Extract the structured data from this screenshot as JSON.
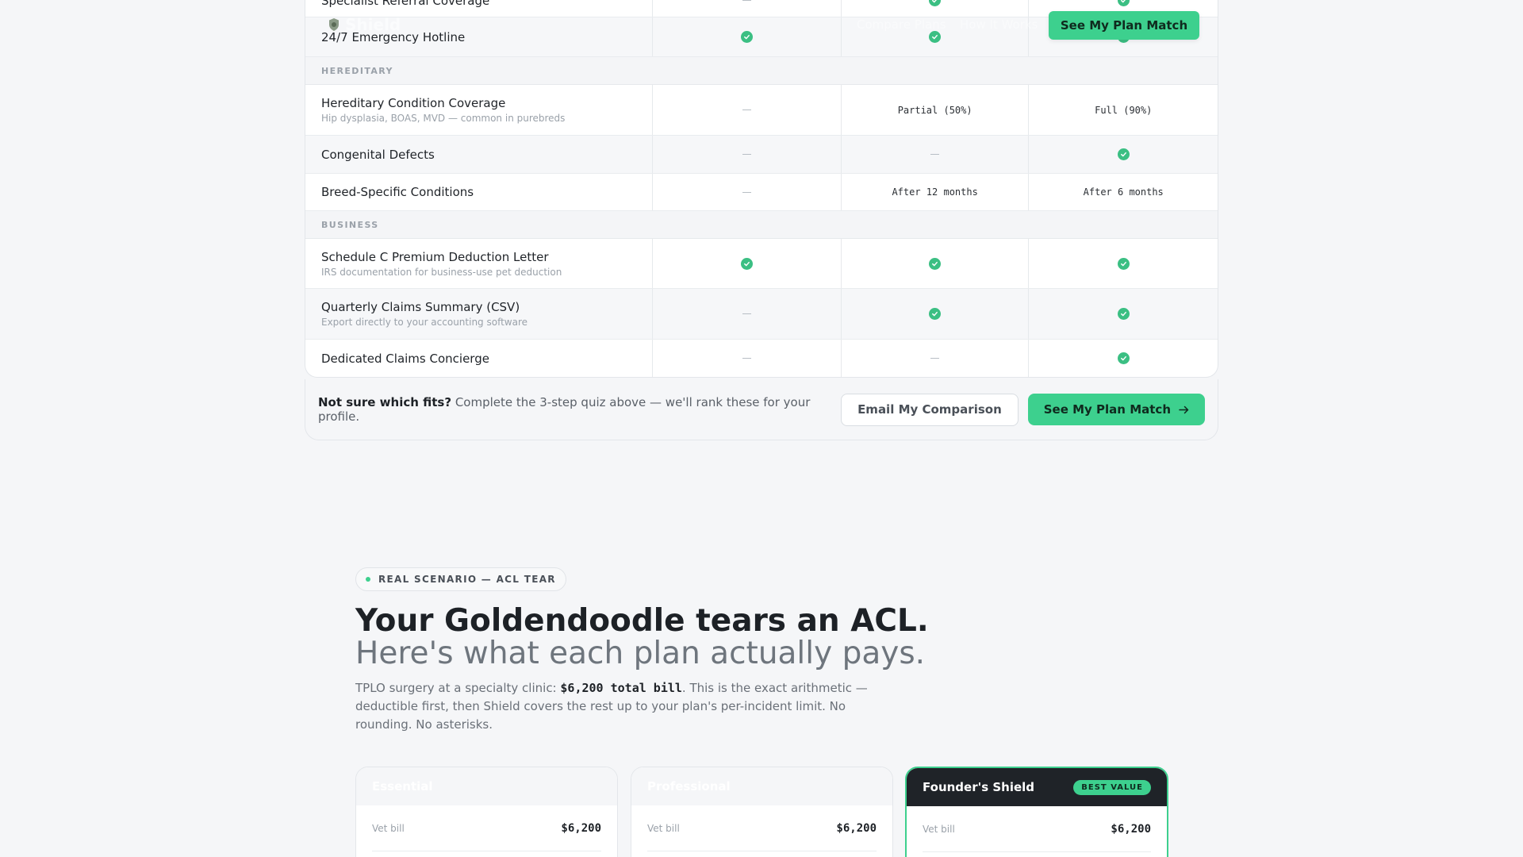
{
  "header": {
    "logo_text": "Shield",
    "nav": [
      "Compare Plans",
      "How It Works"
    ],
    "cta_label": "See My Plan Match"
  },
  "table": {
    "rows": [
      {
        "kind": "feature",
        "label": "Specialist Referral Coverage",
        "values": [
          "dash",
          "check",
          "check"
        ]
      },
      {
        "kind": "feature",
        "label": "24/7 Emergency Hotline",
        "values": [
          "check",
          "check",
          "check"
        ]
      },
      {
        "kind": "section",
        "label": "HEREDITARY"
      },
      {
        "kind": "feature",
        "label": "Hereditary Condition Coverage",
        "sub": "Hip dysplasia, BOAS, MVD — common in purebreds",
        "values": [
          "dash",
          "Partial (50%)",
          "Full (90%)"
        ]
      },
      {
        "kind": "feature",
        "label": "Congenital Defects",
        "values": [
          "dash",
          "dash",
          "check"
        ]
      },
      {
        "kind": "feature",
        "label": "Breed-Specific Conditions",
        "values": [
          "dash",
          "After 12 months",
          "After 6 months"
        ]
      },
      {
        "kind": "section",
        "label": "BUSINESS"
      },
      {
        "kind": "feature",
        "label": "Schedule C Premium Deduction Letter",
        "sub": "IRS documentation for business-use pet deduction",
        "values": [
          "check",
          "check",
          "check"
        ]
      },
      {
        "kind": "feature",
        "label": "Quarterly Claims Summary (CSV)",
        "sub": "Export directly to your accounting software",
        "values": [
          "dash",
          "check",
          "check"
        ]
      },
      {
        "kind": "feature",
        "label": "Dedicated Claims Concierge",
        "values": [
          "dash",
          "dash",
          "check"
        ]
      }
    ]
  },
  "cta_bar": {
    "lead_bold": "Not sure which fits?",
    "lead_text": " Complete the 3-step quiz above — we'll rank these for your profile.",
    "email_label": "Email My Comparison",
    "match_label": "See My Plan Match"
  },
  "scenario": {
    "pill": "REAL SCENARIO — ACL TEAR",
    "title": "Your Goldendoodle tears an ACL.",
    "subtitle": "Here's what each plan actually pays.",
    "lead_pre": "TPLO surgery at a specialty clinic: ",
    "lead_bill": "$6,200 total bill",
    "lead_post": ". This is the exact arithmetic — deductible first, then Shield covers the rest up to your plan's per-incident limit. No rounding. No asterisks.",
    "plans": [
      {
        "name": "Essential",
        "badge": "",
        "bill_label": "Vet bill",
        "bill_value": "$6,200"
      },
      {
        "name": "Professional",
        "badge": "",
        "bill_label": "Vet bill",
        "bill_value": "$6,200"
      },
      {
        "name": "Founder's Shield",
        "badge": "BEST VALUE",
        "bill_label": "Vet bill",
        "bill_value": "$6,200"
      }
    ]
  },
  "colors": {
    "accent": "#3dd08e",
    "check": "#3bbf83",
    "dark": "#1f2328"
  }
}
